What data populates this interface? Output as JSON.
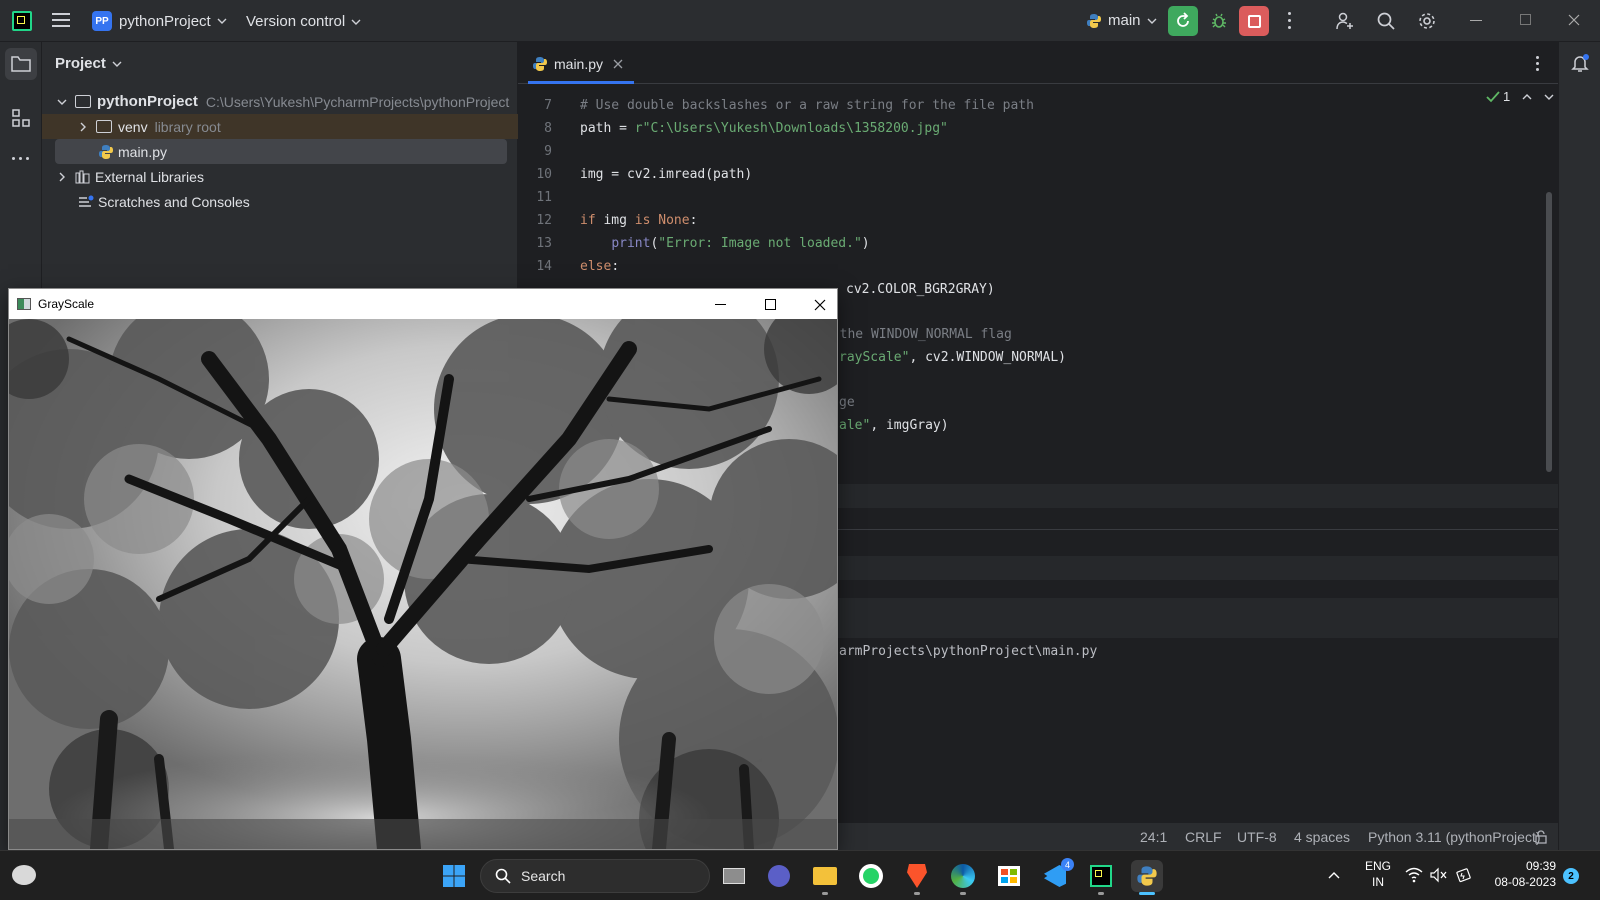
{
  "titlebar": {
    "project_badge": "PP",
    "project_name": "pythonProject",
    "vcs_label": "Version control",
    "run_config": "main"
  },
  "project_panel": {
    "title": "Project",
    "root_name": "pythonProject",
    "root_path": "C:\\Users\\Yukesh\\PycharmProjects\\pythonProject",
    "venv_label": "venv",
    "venv_hint": "library root",
    "main_file": "main.py",
    "external_libs": "External Libraries",
    "scratches": "Scratches and Consoles"
  },
  "editor": {
    "tab_label": "main.py",
    "inspection_count": "1",
    "lines": [
      {
        "n": "7",
        "segments": [
          {
            "t": "# Use double backslashes or a raw string for the file path",
            "c": "cmt"
          }
        ]
      },
      {
        "n": "8",
        "segments": [
          {
            "t": "path = ",
            "c": ""
          },
          {
            "t": "r\"C:\\Users\\Yukesh\\Downloads\\1358200.jpg\"",
            "c": "str"
          }
        ]
      },
      {
        "n": "9",
        "segments": []
      },
      {
        "n": "10",
        "segments": [
          {
            "t": "img = cv2.imread(path)",
            "c": ""
          }
        ]
      },
      {
        "n": "11",
        "segments": []
      },
      {
        "n": "12",
        "segments": [
          {
            "t": "if ",
            "c": "kw"
          },
          {
            "t": "img ",
            "c": ""
          },
          {
            "t": "is None",
            "c": "kw"
          },
          {
            "t": ":",
            "c": ""
          }
        ]
      },
      {
        "n": "13",
        "segments": [
          {
            "t": "    ",
            "c": ""
          },
          {
            "t": "print",
            "c": "builtin"
          },
          {
            "t": "(",
            "c": ""
          },
          {
            "t": "\"Error: Image not loaded.\"",
            "c": "str"
          },
          {
            "t": ")",
            "c": ""
          }
        ]
      },
      {
        "n": "14",
        "segments": [
          {
            "t": "else",
            "c": "kw"
          },
          {
            "t": ":",
            "c": ""
          }
        ]
      }
    ],
    "partial_lines": [
      {
        "text": "cv2.COLOR_BGR2GRAY)",
        "c": ""
      },
      {
        "text": "h the WINDOW_NORMAL flag",
        "c": "cmt"
      },
      {
        "text": "rayScale\", cv2.WINDOW_NORMAL)",
        "c": "mix1"
      },
      {
        "text": "ge",
        "c": "cmt"
      },
      {
        "text": "ale\", imgGray)",
        "c": "mix2"
      },
      {
        "text": "armProjects\\pythonProject\\main.py",
        "c": ""
      }
    ]
  },
  "statusbar": {
    "position": "24:1",
    "line_sep": "CRLF",
    "encoding": "UTF-8",
    "indent": "4 spaces",
    "interpreter": "Python 3.11 (pythonProject)"
  },
  "gray_window": {
    "title": "GrayScale"
  },
  "taskbar": {
    "search_label": "Search",
    "lang_top": "ENG",
    "lang_bottom": "IN",
    "time": "09:39",
    "date": "08-08-2023",
    "notif_count": "2",
    "tray_badge": "4"
  },
  "colors": {
    "accent": "#3574f0",
    "run_green": "#3fa95e",
    "stop_red": "#db5c5c"
  }
}
